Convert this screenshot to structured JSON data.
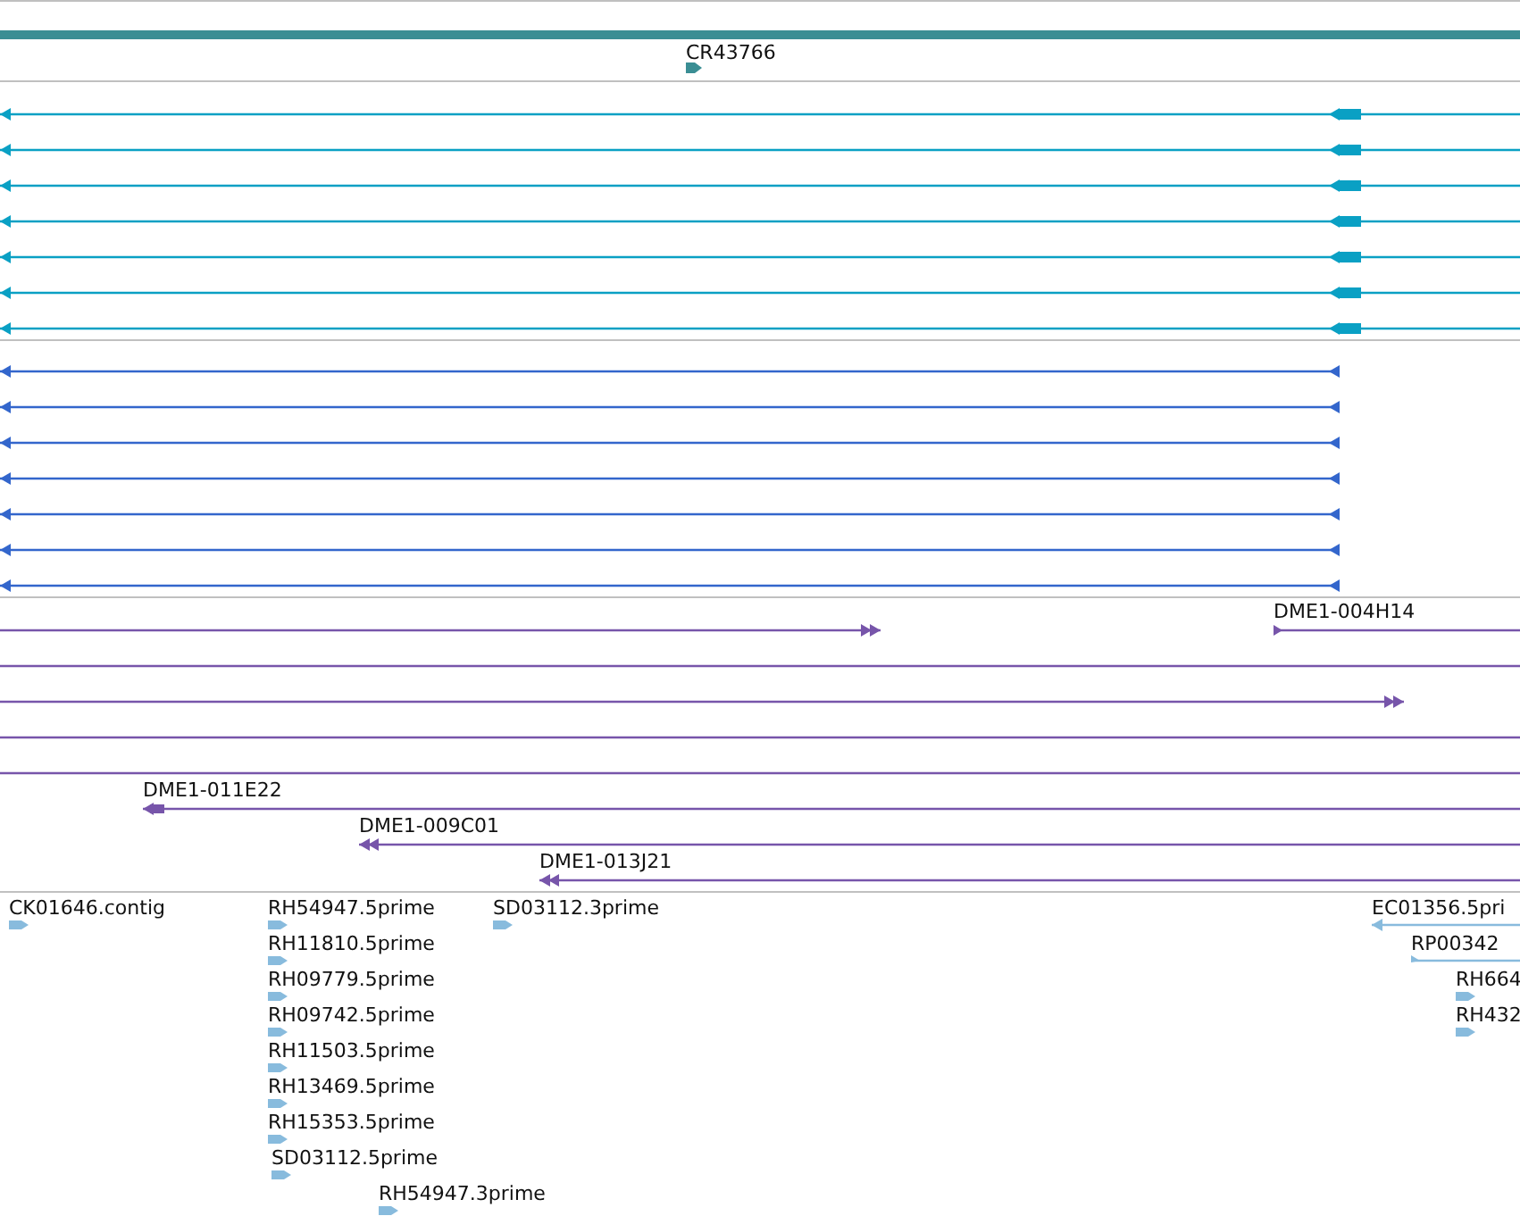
{
  "tracks": [
    {
      "kind": "gene",
      "features": [
        {
          "label": "CR43766",
          "kind": "arrow",
          "reverse": false
        }
      ]
    },
    {
      "kind": "cdna",
      "features": [
        {
          "kind": "arrow",
          "reverse": true
        },
        {
          "kind": "arrow",
          "reverse": true
        },
        {
          "kind": "arrow",
          "reverse": true
        },
        {
          "kind": "arrow",
          "reverse": true
        },
        {
          "kind": "arrow",
          "reverse": true
        },
        {
          "kind": "arrow",
          "reverse": true
        },
        {
          "kind": "arrow",
          "reverse": true
        }
      ]
    },
    {
      "kind": "mrna",
      "features": [
        {
          "kind": "arrow",
          "reverse": true
        },
        {
          "kind": "arrow",
          "reverse": true
        },
        {
          "kind": "arrow",
          "reverse": true
        },
        {
          "kind": "arrow",
          "reverse": true
        },
        {
          "kind": "arrow",
          "reverse": true
        },
        {
          "kind": "arrow",
          "reverse": true
        },
        {
          "kind": "arrow",
          "reverse": true
        }
      ]
    },
    {
      "kind": "clone",
      "features": [
        {
          "kind": "arrow",
          "reverse": false
        },
        {
          "label": "DME1-004H14",
          "kind": "arrow",
          "reverse": false
        },
        {
          "kind": "line"
        },
        {
          "kind": "arrow",
          "reverse": false
        },
        {
          "kind": "line"
        },
        {
          "kind": "line"
        },
        {
          "label": "DME1-011E22",
          "kind": "arrow",
          "reverse": true
        },
        {
          "label": "DME1-009C01",
          "kind": "arrow",
          "reverse": true
        },
        {
          "label": "DME1-013J21",
          "kind": "arrow",
          "reverse": true
        }
      ]
    },
    {
      "kind": "est",
      "features": [
        {
          "label": "CK01646.contig",
          "kind": "arrow",
          "reverse": false
        },
        {
          "label": "RH54947.5prime",
          "kind": "arrow",
          "reverse": false
        },
        {
          "label": "RH11810.5prime",
          "kind": "arrow",
          "reverse": false
        },
        {
          "label": "RH09779.5prime",
          "kind": "arrow",
          "reverse": false
        },
        {
          "label": "RH09742.5prime",
          "kind": "arrow",
          "reverse": false
        },
        {
          "label": "RH11503.5prime",
          "kind": "arrow",
          "reverse": false
        },
        {
          "label": "RH13469.5prime",
          "kind": "arrow",
          "reverse": false
        },
        {
          "label": "RH15353.5prime",
          "kind": "arrow",
          "reverse": false
        },
        {
          "label": "SD03112.5prime",
          "kind": "arrow",
          "reverse": false
        },
        {
          "label": "RH54947.3prime",
          "kind": "arrow",
          "reverse": false
        },
        {
          "label": "SD03112.3prime",
          "kind": "arrow",
          "reverse": false
        },
        {
          "label": "EC01356.5pri",
          "kind": "arrow",
          "reverse": true
        },
        {
          "label": "RP00342",
          "kind": "arrow",
          "reverse": false
        },
        {
          "label": "RH664",
          "kind": "arrow",
          "reverse": false
        },
        {
          "label": "RH432",
          "kind": "arrow",
          "reverse": false
        }
      ]
    }
  ]
}
